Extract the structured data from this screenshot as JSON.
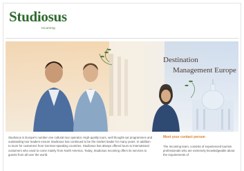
{
  "brand": {
    "name_prefix": "Studio",
    "name_suffix": "sus",
    "subtitle": "Incoming",
    "color_main": "#2f6a2f",
    "color_accent": "#a6c234"
  },
  "hero": {
    "title_line1": "Destination",
    "title_line2": "Management Europe"
  },
  "body": {
    "paragraph": "Studiosus is Europe's number one cultural tour operator. High-quality tours, well thought-out programmes and outstanding tour leaders ensure Studiosus has continued to be the market leader for many years. In addition to tours for customers from German-speaking countries, Studiosus has always offered tours to international customers who used to come mainly from North America. Today, Studiosus Incoming offers its services to guests from all over the world."
  },
  "sidebar": {
    "heading": "Meet your contact person",
    "text": "The Incoming team, consists of experienced tourism professionals who are extremely knowledgeable about the requirements of"
  }
}
